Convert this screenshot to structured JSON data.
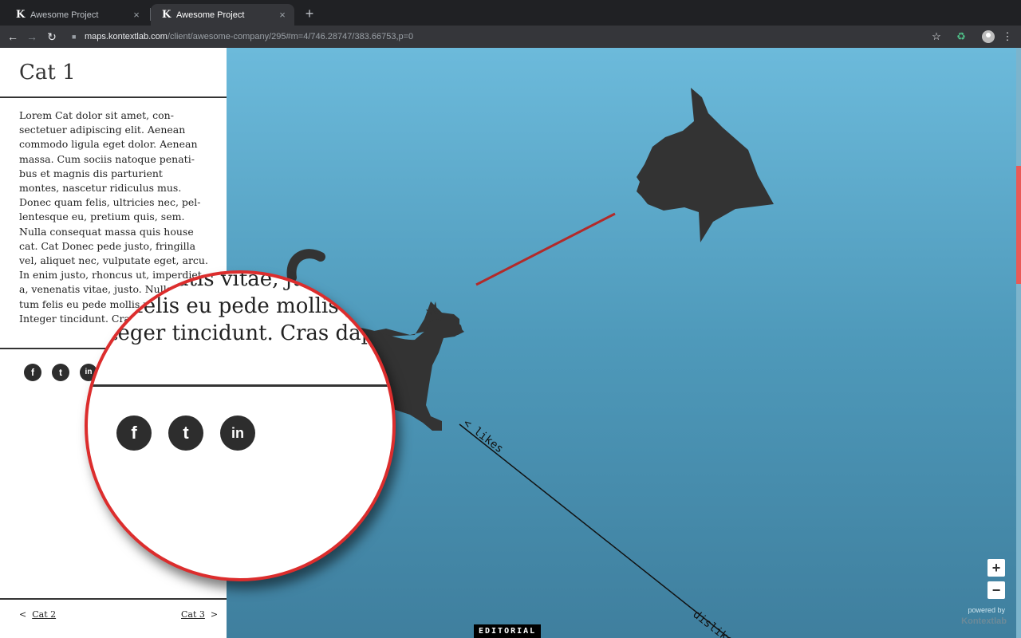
{
  "browser": {
    "tabs": [
      {
        "icon": "K",
        "title": "Awesome Project",
        "close": "×"
      },
      {
        "icon": "K",
        "title": "Awesome Project",
        "close": "×"
      }
    ],
    "new_tab": "+",
    "url_host": "maps.kontextlab.com",
    "url_path": "/client/awesome-company/295#m=4/746.28747/383.66753,p=0"
  },
  "sidebar": {
    "title": "Cat 1",
    "body": "Lorem Cat dolor sit amet, con-\nsectetuer adipiscing elit. Aenean\ncommodo ligula eget dolor. Aenean\nmassa. Cum sociis natoque penati-\nbus et magnis dis parturient\nmontes, nascetur ridiculus mus.\nDonec quam felis, ultricies nec, pel-\nlentesque eu, pretium quis, sem.\nNulla consequat massa quis house\ncat. Cat Donec pede justo, fringilla\nvel, aliquet nec, vulputate eget, arcu.\nIn enim justo, rhoncus ut, imperdiet\na, venenatis vitae, justo. Nullam dic-\ntum felis eu pede mollis pretium.\nInteger tincidunt. Cras dapibus.",
    "social": [
      "f",
      "t",
      "in"
    ],
    "prev_arrow": "<",
    "prev_label": "Cat 2",
    "next_label": "Cat 3",
    "next_arrow": ">"
  },
  "magnifier": {
    "text": "a, venenatis vitae, justo. Null\ntum felis eu pede mollis pretium\nInteger tincidunt. Cras dapibus.",
    "social": [
      "f",
      "t",
      "in"
    ]
  },
  "map": {
    "likes_label": "< likes",
    "dislikes_label": "dislikes",
    "zoom_in": "+",
    "zoom_out": "−",
    "powered_by": "powered by",
    "brand": "Kontextlab",
    "editorial": "EDITORIAL"
  },
  "colors": {
    "accent": "#dc2d2d",
    "silhouette": "#333333",
    "map_top": "#6cbadb",
    "map_bottom": "#3f7f9e"
  }
}
